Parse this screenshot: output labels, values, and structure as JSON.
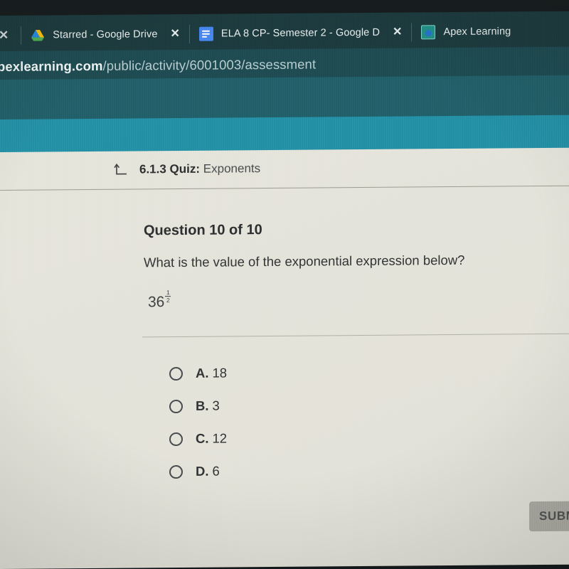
{
  "browser": {
    "tabs": [
      {
        "title": "Starred - Google Drive",
        "favicon": "google-drive-icon",
        "close_label": "✕"
      },
      {
        "title": "ELA 8 CP- Semester 2 - Google D",
        "favicon": "google-docs-icon",
        "close_label": "✕"
      },
      {
        "title": "Apex Learning",
        "favicon": "apex-learning-icon",
        "close_label": ""
      }
    ],
    "url": {
      "host": "pexlearning.com",
      "path": "/public/activity/6001003/assessment",
      "full": "pexlearning.com/public/activity/6001003/assessment"
    }
  },
  "quiz": {
    "back_icon": "back-arrow-icon",
    "lesson_number": "6.1.3",
    "type_label": "Quiz:",
    "subject": "Exponents",
    "question_counter": "Question 10 of 10",
    "prompt": "What is the value of the exponential expression below?",
    "expression": {
      "base": "36",
      "exponent_numerator": "1",
      "exponent_denominator": "2",
      "plain": "36^(1/2)"
    },
    "options": [
      {
        "letter": "A.",
        "value": "18",
        "selected": false
      },
      {
        "letter": "B.",
        "value": "3",
        "selected": false
      },
      {
        "letter": "C.",
        "value": "12",
        "selected": false
      },
      {
        "letter": "D.",
        "value": "6",
        "selected": false
      }
    ],
    "submit_label": "SUBMIT"
  },
  "colors": {
    "tabbar_bg": "#15343a",
    "urlbar_bg": "#17464e",
    "band_dark": "#1b5c67",
    "band_bright": "#1e90a8",
    "page_bg": "#e9e7de",
    "submit_bg": "#b0aea6",
    "text_dark": "#2c2e30"
  }
}
